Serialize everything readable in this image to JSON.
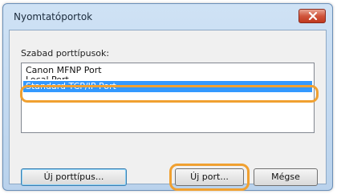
{
  "window": {
    "title": "Nyomtatóportok",
    "close_icon": "close-icon"
  },
  "ports": {
    "label": "Szabad porttípusok:",
    "items": [
      "Canon MFNP Port",
      "Local Port",
      "Standard TCP/IP Port"
    ],
    "selected_index": 2
  },
  "buttons": {
    "new_port_type": "Új porttípus...",
    "new_port": "Új port...",
    "cancel": "Mégse"
  },
  "colors": {
    "highlight_ring": "#f0a030",
    "selection": "#3399ff"
  }
}
